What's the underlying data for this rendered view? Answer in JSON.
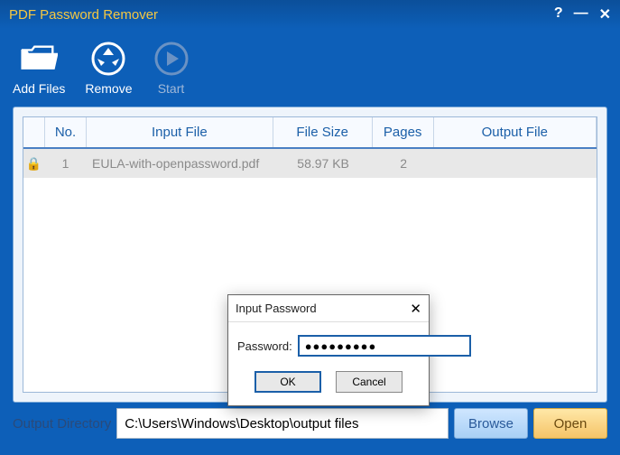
{
  "window": {
    "title": "PDF Password Remover"
  },
  "toolbar": {
    "addFiles": "Add Files",
    "remove": "Remove",
    "start": "Start"
  },
  "table": {
    "headers": {
      "no": "No.",
      "inputFile": "Input File",
      "fileSize": "File Size",
      "pages": "Pages",
      "outputFile": "Output File"
    },
    "rows": [
      {
        "no": "1",
        "inputFile": "EULA-with-openpassword.pdf",
        "fileSize": "58.97 KB",
        "pages": "2",
        "outputFile": ""
      }
    ]
  },
  "output": {
    "label": "Output Directory",
    "path": "C:\\Users\\Windows\\Desktop\\output files",
    "browse": "Browse",
    "open": "Open"
  },
  "modal": {
    "title": "Input Password",
    "label": "Password:",
    "value": "●●●●●●●●●",
    "ok": "OK",
    "cancel": "Cancel"
  }
}
